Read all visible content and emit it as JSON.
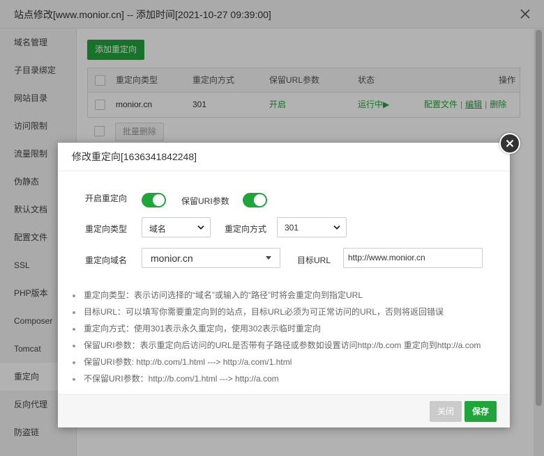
{
  "window": {
    "title": "站点修改[www.monior.cn] -- 添加时间[2021-10-27 09:39:00]"
  },
  "sidebar": {
    "items": [
      {
        "label": "域名管理"
      },
      {
        "label": "子目录绑定"
      },
      {
        "label": "网站目录"
      },
      {
        "label": "访问限制"
      },
      {
        "label": "流量限制"
      },
      {
        "label": "伪静态"
      },
      {
        "label": "默认文档"
      },
      {
        "label": "配置文件"
      },
      {
        "label": "SSL"
      },
      {
        "label": "PHP版本"
      },
      {
        "label": "Composer"
      },
      {
        "label": "Tomcat"
      },
      {
        "label": "重定向",
        "active": true
      },
      {
        "label": "反向代理"
      },
      {
        "label": "防盗链"
      }
    ]
  },
  "main": {
    "add_button": "添加重定向",
    "table": {
      "headers": {
        "type": "重定向类型",
        "method": "重定向方式",
        "keep": "保留URL参数",
        "status": "状态",
        "actions": "操作"
      },
      "rows": [
        {
          "type": "monior.cn",
          "method": "301",
          "keep": "开启",
          "status": "运行中▶",
          "action_config": "配置文件",
          "action_edit": "编辑",
          "action_delete": "删除"
        }
      ],
      "separator": "|"
    },
    "bulk_delete": "批量删除"
  },
  "modal": {
    "title": "修改重定向[1636341842248]",
    "enable_label": "开启重定向",
    "keep_uri_label": "保留URI参数",
    "type_label": "重定向类型",
    "type_value": "域名",
    "method_label": "重定向方式",
    "method_value": "301",
    "domain_label": "重定向域名",
    "domain_value": "monior.cn",
    "target_label": "目标URL",
    "target_value": "http://www.monior.cn",
    "tips": [
      "重定向类型：表示访问选择的“域名”或输入的“路径”时将会重定向到指定URL",
      "目标URL：可以填写你需要重定向到的站点，目标URL必须为可正常访问的URL，否则将返回错误",
      "重定向方式：使用301表示永久重定向，使用302表示临时重定向",
      "保留URI参数：表示重定向后访问的URL是否带有子路径或参数如设置访问http://b.com 重定向到http://a.com",
      "保留URI参数:  http://b.com/1.html ---> http://a.com/1.html",
      "不保留URI参数：http://b.com/1.html ---> http://a.com"
    ],
    "close_button": "关闭",
    "save_button": "保存"
  },
  "colors": {
    "accent": "#20a53a",
    "disabled": "#cbcbcb"
  }
}
